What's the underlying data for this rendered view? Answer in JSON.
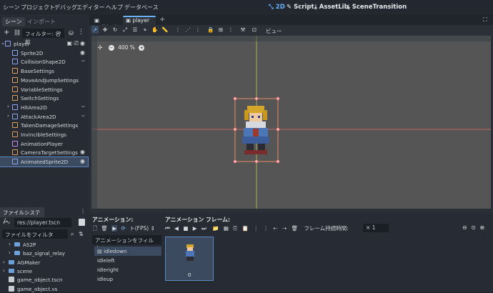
{
  "menubar": {
    "items": [
      "シーン",
      "プロジェクト",
      "デバッグ",
      "エディター",
      "ヘルプ",
      "データベース"
    ],
    "workspaces": [
      {
        "label": "2D",
        "icon": "2d-icon",
        "active": true
      },
      {
        "label": "Script",
        "icon": "script-icon",
        "active": false
      },
      {
        "label": "AssetLib",
        "icon": "assetlib-icon",
        "active": false
      },
      {
        "label": "SceneTransition",
        "icon": "scene-transition-icon",
        "active": false
      }
    ]
  },
  "scene_dock": {
    "tabs": [
      "シーン",
      "インポート"
    ],
    "filter_placeholder": "フィルター: 名前",
    "tree": [
      {
        "label": "player",
        "icon": "node2d-icon",
        "color": "#8da5f3",
        "indent": 0,
        "extra": "eye"
      },
      {
        "label": "Sprite2D",
        "icon": "sprite-icon",
        "color": "#8da5f3",
        "indent": 1,
        "extra": "eye"
      },
      {
        "label": "CollisionShape2D",
        "icon": "collision-icon",
        "color": "#8da5f3",
        "indent": 1,
        "extra": "signal"
      },
      {
        "label": "BaseSettings",
        "icon": "settings-icon",
        "color": "#e0a05a",
        "indent": 1,
        "extra": ""
      },
      {
        "label": "MoveAndJumpSettings",
        "icon": "settings-icon",
        "color": "#e0a05a",
        "indent": 1,
        "extra": ""
      },
      {
        "label": "VariableSettings",
        "icon": "settings-icon",
        "color": "#e0a05a",
        "indent": 1,
        "extra": ""
      },
      {
        "label": "SwitchSettings",
        "icon": "settings-icon",
        "color": "#e0a05a",
        "indent": 1,
        "extra": ""
      },
      {
        "label": "HitArea2D",
        "icon": "area-icon",
        "color": "#8da5f3",
        "indent": 1,
        "extra": "signal"
      },
      {
        "label": "AttackArea2D",
        "icon": "area-icon",
        "color": "#8da5f3",
        "indent": 1,
        "extra": "signal"
      },
      {
        "label": "TakenDamageSettings",
        "icon": "settings-icon",
        "color": "#e0a05a",
        "indent": 1,
        "extra": ""
      },
      {
        "label": "InvincibleSettings",
        "icon": "settings-icon",
        "color": "#e0a05a",
        "indent": 1,
        "extra": ""
      },
      {
        "label": "AnimationPlayer",
        "icon": "animation-player-icon",
        "color": "#c38ef1",
        "indent": 1,
        "extra": ""
      },
      {
        "label": "CameraTargetSettings",
        "icon": "settings-icon",
        "color": "#e0a05a",
        "indent": 1,
        "extra": "eye"
      },
      {
        "label": "AnimatedSprite2D",
        "icon": "animated-sprite-icon",
        "color": "#8da5f3",
        "indent": 1,
        "extra": "eye",
        "selected": true
      }
    ]
  },
  "fs_dock": {
    "title": "ファイルシステム",
    "path": "res://player.tscn",
    "filter_placeholder": "ファイルをフィルタ",
    "items": [
      {
        "label": "AS2P",
        "type": "folder"
      },
      {
        "label": "baz_signal_relay",
        "type": "folder"
      },
      {
        "label": "AGMaker",
        "type": "folder"
      },
      {
        "label": "scene",
        "type": "folder"
      },
      {
        "label": "game_object.tscn",
        "type": "file"
      },
      {
        "label": "game_object.vs",
        "type": "file"
      }
    ]
  },
  "editor_tabs": [
    {
      "label": "walktest",
      "active": false
    },
    {
      "label": "player",
      "active": true
    }
  ],
  "toolbar": {
    "view_label": "ビュー"
  },
  "canvas": {
    "zoom": "400 %"
  },
  "animations": {
    "title": "アニメーション:",
    "frames_title": "アニメーション フレーム:",
    "fps_label": "ト(FPS)",
    "filter_placeholder": "アニメーションをフィルタ",
    "duration_label": "フレーム持続時間:",
    "duration_value": "× 1",
    "list": [
      "idledown",
      "idleleft",
      "idleright",
      "idleup"
    ],
    "selected": "idledown",
    "frame_index": "0"
  }
}
